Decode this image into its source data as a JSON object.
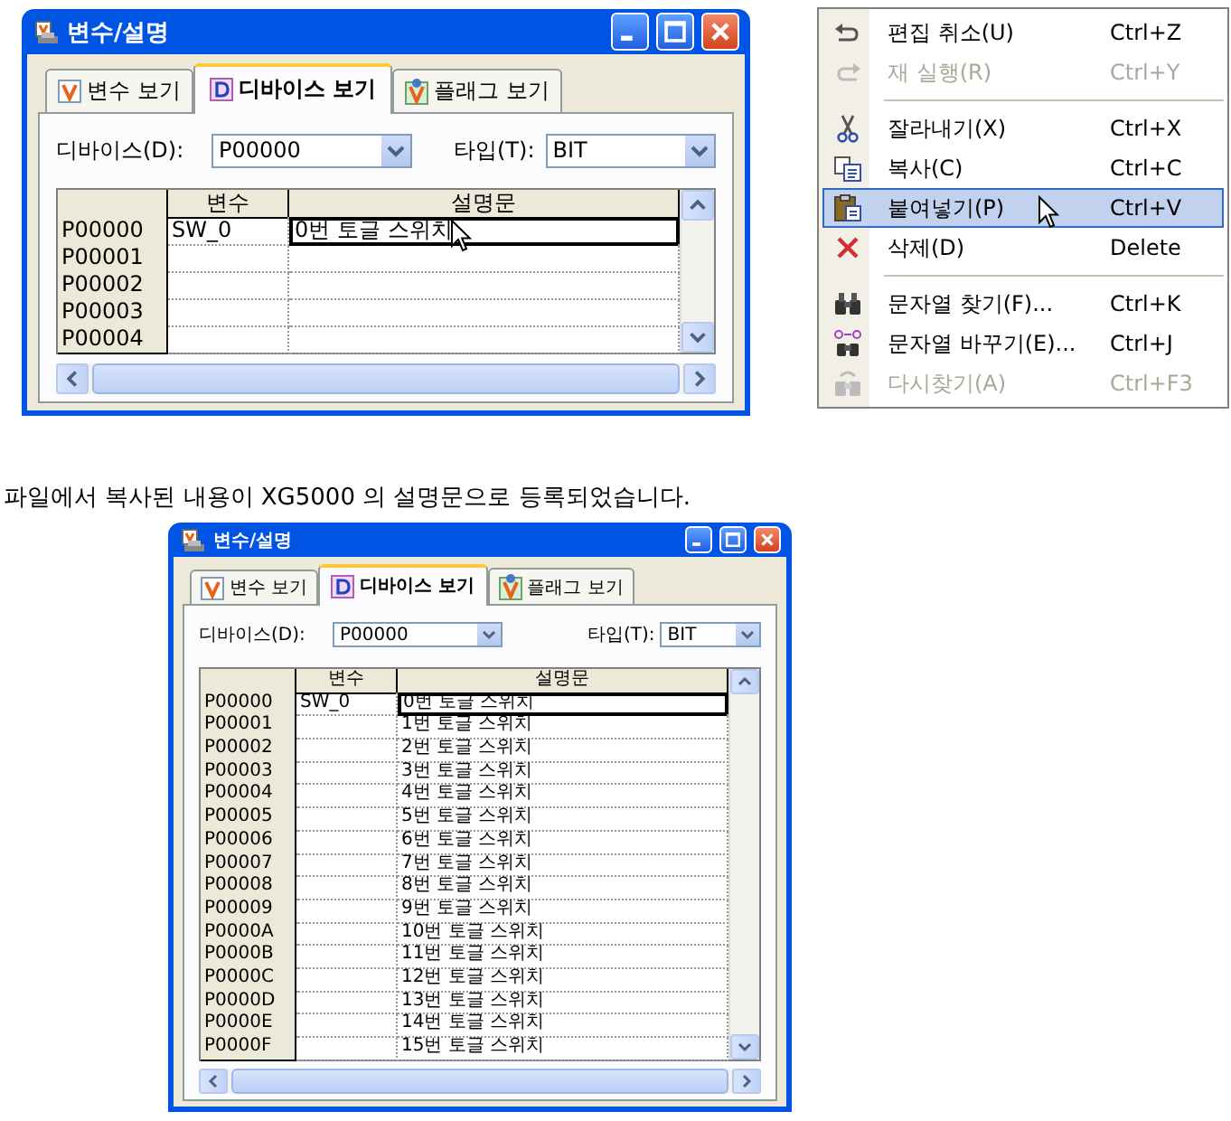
{
  "top_window": {
    "title": "변수/설명",
    "tabs": [
      {
        "label": "변수 보기",
        "selected": false
      },
      {
        "label": "디바이스 보기",
        "selected": true
      },
      {
        "label": "플래그 보기",
        "selected": false
      }
    ],
    "device": {
      "label": "디바이스(D):",
      "value": "P00000"
    },
    "type": {
      "label": "타입(T):",
      "value": "BIT"
    },
    "columns": [
      "변수",
      "설명문"
    ],
    "rows": [
      {
        "address": "P00000",
        "variable": "SW_0",
        "description": "0번 토글 스위치",
        "selected": true
      },
      {
        "address": "P00001",
        "variable": "",
        "description": "",
        "selected": false
      },
      {
        "address": "P00002",
        "variable": "",
        "description": "",
        "selected": false
      },
      {
        "address": "P00003",
        "variable": "",
        "description": "",
        "selected": false
      },
      {
        "address": "P00004",
        "variable": "",
        "description": "",
        "selected": false
      }
    ]
  },
  "context_menu": {
    "items": [
      {
        "kind": "item",
        "label": "편집 취소(U)",
        "shortcut": "Ctrl+Z",
        "disabled": false,
        "selected": false
      },
      {
        "kind": "item",
        "label": "재 실행(R)",
        "shortcut": "Ctrl+Y",
        "disabled": true,
        "selected": false
      },
      {
        "kind": "separator"
      },
      {
        "kind": "item",
        "label": "잘라내기(X)",
        "shortcut": "Ctrl+X",
        "disabled": false,
        "selected": false
      },
      {
        "kind": "item",
        "label": "복사(C)",
        "shortcut": "Ctrl+C",
        "disabled": false,
        "selected": false
      },
      {
        "kind": "item",
        "label": "붙여넣기(P)",
        "shortcut": "Ctrl+V",
        "disabled": false,
        "selected": true
      },
      {
        "kind": "item",
        "label": "삭제(D)",
        "shortcut": "Delete",
        "disabled": false,
        "selected": false
      },
      {
        "kind": "separator"
      },
      {
        "kind": "item",
        "label": "문자열 찾기(F)...",
        "shortcut": "Ctrl+K",
        "disabled": false,
        "selected": false
      },
      {
        "kind": "item",
        "label": "문자열 바꾸기(E)...",
        "shortcut": "Ctrl+J",
        "disabled": false,
        "selected": false
      },
      {
        "kind": "item",
        "label": "다시찾기(A)",
        "shortcut": "Ctrl+F3",
        "disabled": true,
        "selected": false
      }
    ]
  },
  "caption": "파일에서 복사된 내용이 XG5000 의 설명문으로 등록되었습니다.",
  "bottom_window": {
    "title": "변수/설명",
    "tabs": [
      {
        "label": "변수 보기",
        "selected": false
      },
      {
        "label": "디바이스 보기",
        "selected": true
      },
      {
        "label": "플래그 보기",
        "selected": false
      }
    ],
    "device": {
      "label": "디바이스(D):",
      "value": "P00000"
    },
    "type": {
      "label": "타입(T):",
      "value": "BIT"
    },
    "columns": [
      "변수",
      "설명문"
    ],
    "rows": [
      {
        "address": "P00000",
        "variable": "SW_0",
        "description": "0번 토글 스위치",
        "selected": true
      },
      {
        "address": "P00001",
        "variable": "",
        "description": "1번 토글 스위치",
        "selected": false
      },
      {
        "address": "P00002",
        "variable": "",
        "description": "2번 토글 스위치",
        "selected": false
      },
      {
        "address": "P00003",
        "variable": "",
        "description": "3번 토글 스위치",
        "selected": false
      },
      {
        "address": "P00004",
        "variable": "",
        "description": "4번 토글 스위치",
        "selected": false
      },
      {
        "address": "P00005",
        "variable": "",
        "description": "5번 토글 스위치",
        "selected": false
      },
      {
        "address": "P00006",
        "variable": "",
        "description": "6번 토글 스위치",
        "selected": false
      },
      {
        "address": "P00007",
        "variable": "",
        "description": "7번 토글 스위치",
        "selected": false
      },
      {
        "address": "P00008",
        "variable": "",
        "description": "8번 토글 스위치",
        "selected": false
      },
      {
        "address": "P00009",
        "variable": "",
        "description": "9번 토글 스위치",
        "selected": false
      },
      {
        "address": "P0000A",
        "variable": "",
        "description": "10번 토글 스위치",
        "selected": false
      },
      {
        "address": "P0000B",
        "variable": "",
        "description": "11번 토글 스위치",
        "selected": false
      },
      {
        "address": "P0000C",
        "variable": "",
        "description": "12번 토글 스위치",
        "selected": false
      },
      {
        "address": "P0000D",
        "variable": "",
        "description": "13번 토글 스위치",
        "selected": false
      },
      {
        "address": "P0000E",
        "variable": "",
        "description": "14번 토글 스위치",
        "selected": false
      },
      {
        "address": "P0000F",
        "variable": "",
        "description": "15번 토글 스위치",
        "selected": false
      }
    ]
  }
}
